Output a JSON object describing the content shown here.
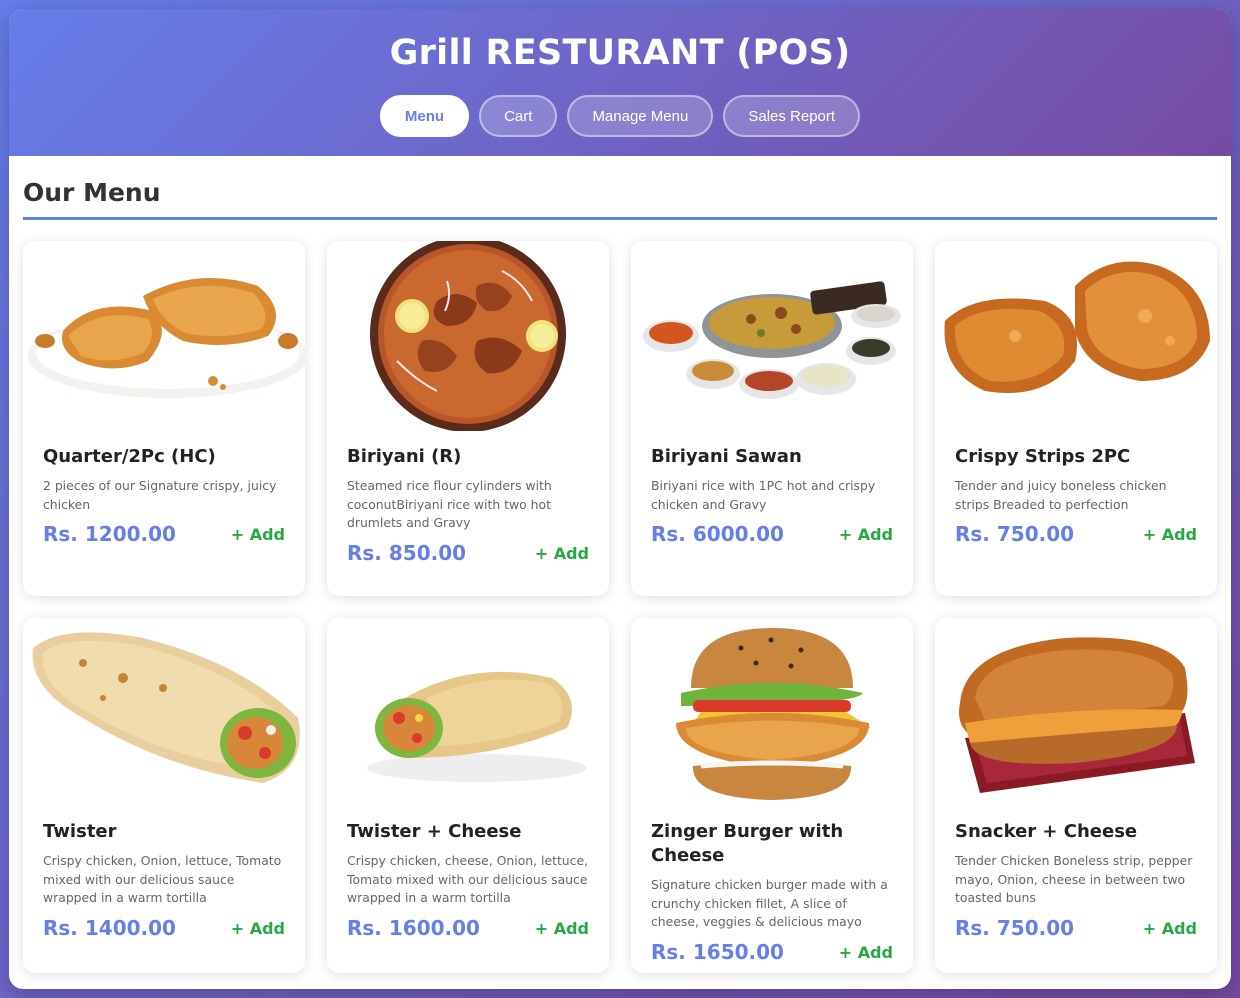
{
  "header": {
    "title": "Grill RESTURANT (POS)",
    "nav": [
      {
        "label": "Menu",
        "active": true
      },
      {
        "label": "Cart",
        "active": false
      },
      {
        "label": "Manage Menu",
        "active": false
      },
      {
        "label": "Sales Report",
        "active": false
      }
    ]
  },
  "menu": {
    "title": "Our Menu",
    "add_label": "+ Add",
    "items": [
      {
        "name": "Quarter/2Pc (HC)",
        "description": "2 pieces of our Signature crispy, juicy chicken",
        "price": "Rs. 1200.00",
        "icon": "fried-chicken-image"
      },
      {
        "name": "Biriyani (R)",
        "description": "Steamed rice flour cylinders with coconutBiriyani rice with two hot drumlets and Gravy",
        "price": "Rs. 850.00",
        "icon": "biriyani-image"
      },
      {
        "name": "Biriyani Sawan",
        "description": "Biriyani rice with 1PC hot and crispy chicken and Gravy",
        "price": "Rs. 6000.00",
        "icon": "biriyani-sawan-image"
      },
      {
        "name": "Crispy Strips 2PC",
        "description": "Tender and juicy boneless chicken strips Breaded to perfection",
        "price": "Rs. 750.00",
        "icon": "crispy-strips-image"
      },
      {
        "name": "Twister",
        "description": "Crispy chicken, Onion, lettuce, Tomato mixed with our delicious sauce wrapped in a warm tortilla",
        "price": "Rs. 1400.00",
        "icon": "twister-image"
      },
      {
        "name": "Twister + Cheese",
        "description": "Crispy chicken, cheese, Onion, lettuce, Tomato mixed with our delicious sauce wrapped in a warm tortilla",
        "price": "Rs. 1600.00",
        "icon": "twister-cheese-image"
      },
      {
        "name": "Zinger Burger with Cheese",
        "description": "Signature chicken burger made with a crunchy chicken fillet, A slice of cheese, veggies & delicious mayo",
        "price": "Rs. 1650.00",
        "icon": "zinger-burger-image"
      },
      {
        "name": "Snacker + Cheese",
        "description": "Tender Chicken Boneless strip, pepper mayo, Onion, cheese in between two toasted buns",
        "price": "Rs. 750.00",
        "icon": "snacker-image"
      }
    ]
  },
  "colors": {
    "accent": "#667eea",
    "gradient_end": "#764ba2",
    "add": "#28a745"
  }
}
